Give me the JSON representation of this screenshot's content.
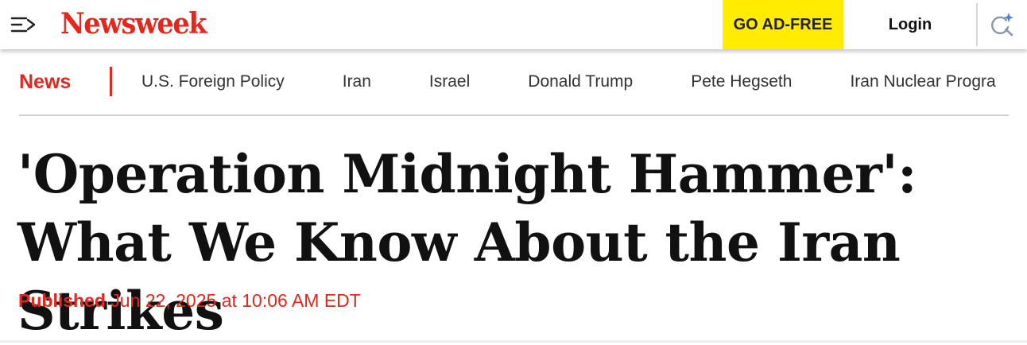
{
  "header": {
    "logo_text": "Newsweek",
    "ad_free_label": "GO AD-FREE",
    "login_label": "Login",
    "menu_icon": "menu-arrow-icon",
    "search_icon": "ai-search-icon"
  },
  "subnav": {
    "section_label": "News",
    "topics": [
      "U.S. Foreign Policy",
      "Iran",
      "Israel",
      "Donald Trump",
      "Pete Hegseth",
      "Iran Nuclear Progra"
    ]
  },
  "article": {
    "headline": "'Operation Midnight Hammer': What We Know About the Iran Strikes",
    "published_label": "Published",
    "published_date": "Jun 22, 2025 at 10:06 AM EDT"
  },
  "colors": {
    "brand_red": "#e4261c",
    "ad_free_yellow": "#ffec00",
    "headline_black": "#111111"
  }
}
